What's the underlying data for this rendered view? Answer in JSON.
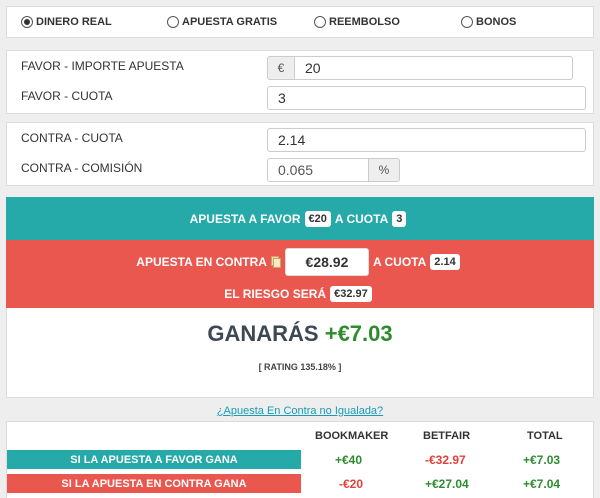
{
  "options": [
    {
      "label": "DINERO REAL",
      "checked": true
    },
    {
      "label": "APUESTA GRATIS",
      "checked": false
    },
    {
      "label": "REEMBOLSO",
      "checked": false
    },
    {
      "label": "BONOS",
      "checked": false
    }
  ],
  "favor": {
    "importe_label": "FAVOR - IMPORTE APUESTA",
    "currency": "€",
    "importe_value": "20",
    "cuota_label": "FAVOR - CUOTA",
    "cuota_value": "3"
  },
  "contra": {
    "cuota_label": "CONTRA - CUOTA",
    "cuota_value": "2.14",
    "comision_label": "CONTRA - COMISIÓN",
    "comision_value": "0.065",
    "comision_unit": "%"
  },
  "band_favor": {
    "prefix": "APUESTA A FAVOR",
    "amount": "€20",
    "mid": "A CUOTA",
    "odds": "3"
  },
  "band_contra": {
    "prefix": "APUESTA EN CONTRA",
    "amount": "€28.92",
    "mid": "A CUOTA",
    "odds": "2.14",
    "risk_label": "EL RIESGO SERÁ",
    "risk_amount": "€32.97"
  },
  "result": {
    "label": "GANARÁS",
    "profit": "+€7.03",
    "rating": "[ RATING 135.18% ]"
  },
  "link_text": "¿Apuesta En Contra no Igualada?",
  "table": {
    "headers": [
      "BOOKMAKER",
      "BETFAIR",
      "TOTAL"
    ],
    "rows": [
      {
        "label": "SI LA APUESTA A FAVOR GANA",
        "bookmaker": "+€40",
        "betfair": "-€32.97",
        "total": "+€7.03"
      },
      {
        "label": "SI LA APUESTA EN CONTRA GANA",
        "bookmaker": "-€20",
        "betfair": "+€27.04",
        "total": "+€7.04"
      }
    ]
  },
  "colors": {
    "teal": "#26a9a9",
    "red": "#e9574f",
    "positive": "#2e8b2e",
    "negative": "#e2403a"
  }
}
